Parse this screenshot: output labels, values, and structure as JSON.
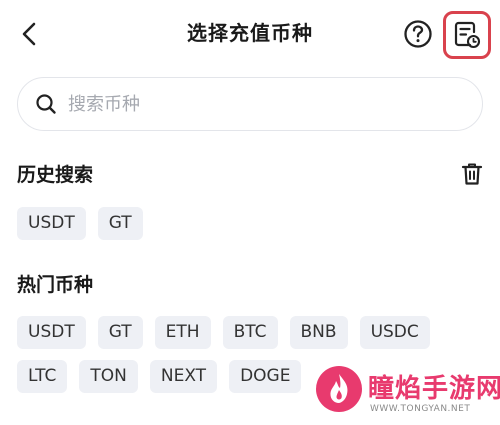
{
  "header": {
    "title": "选择充值币种"
  },
  "search": {
    "placeholder": "搜索币种"
  },
  "history": {
    "title": "历史搜索",
    "items": [
      "USDT",
      "GT"
    ]
  },
  "hot": {
    "title": "热门币种",
    "row1": [
      "USDT",
      "GT",
      "ETH",
      "BTC",
      "BNB",
      "USDC"
    ],
    "row2": [
      "LTC",
      "TON",
      "NEXT",
      "DOGE"
    ]
  },
  "watermark": {
    "name": "瞳焰手游网",
    "url": "WWW.TONGYAN.NET"
  },
  "colors": {
    "highlight_border": "#d9424d",
    "chip_bg": "#eef0f5",
    "watermark": "#e83a6e"
  }
}
